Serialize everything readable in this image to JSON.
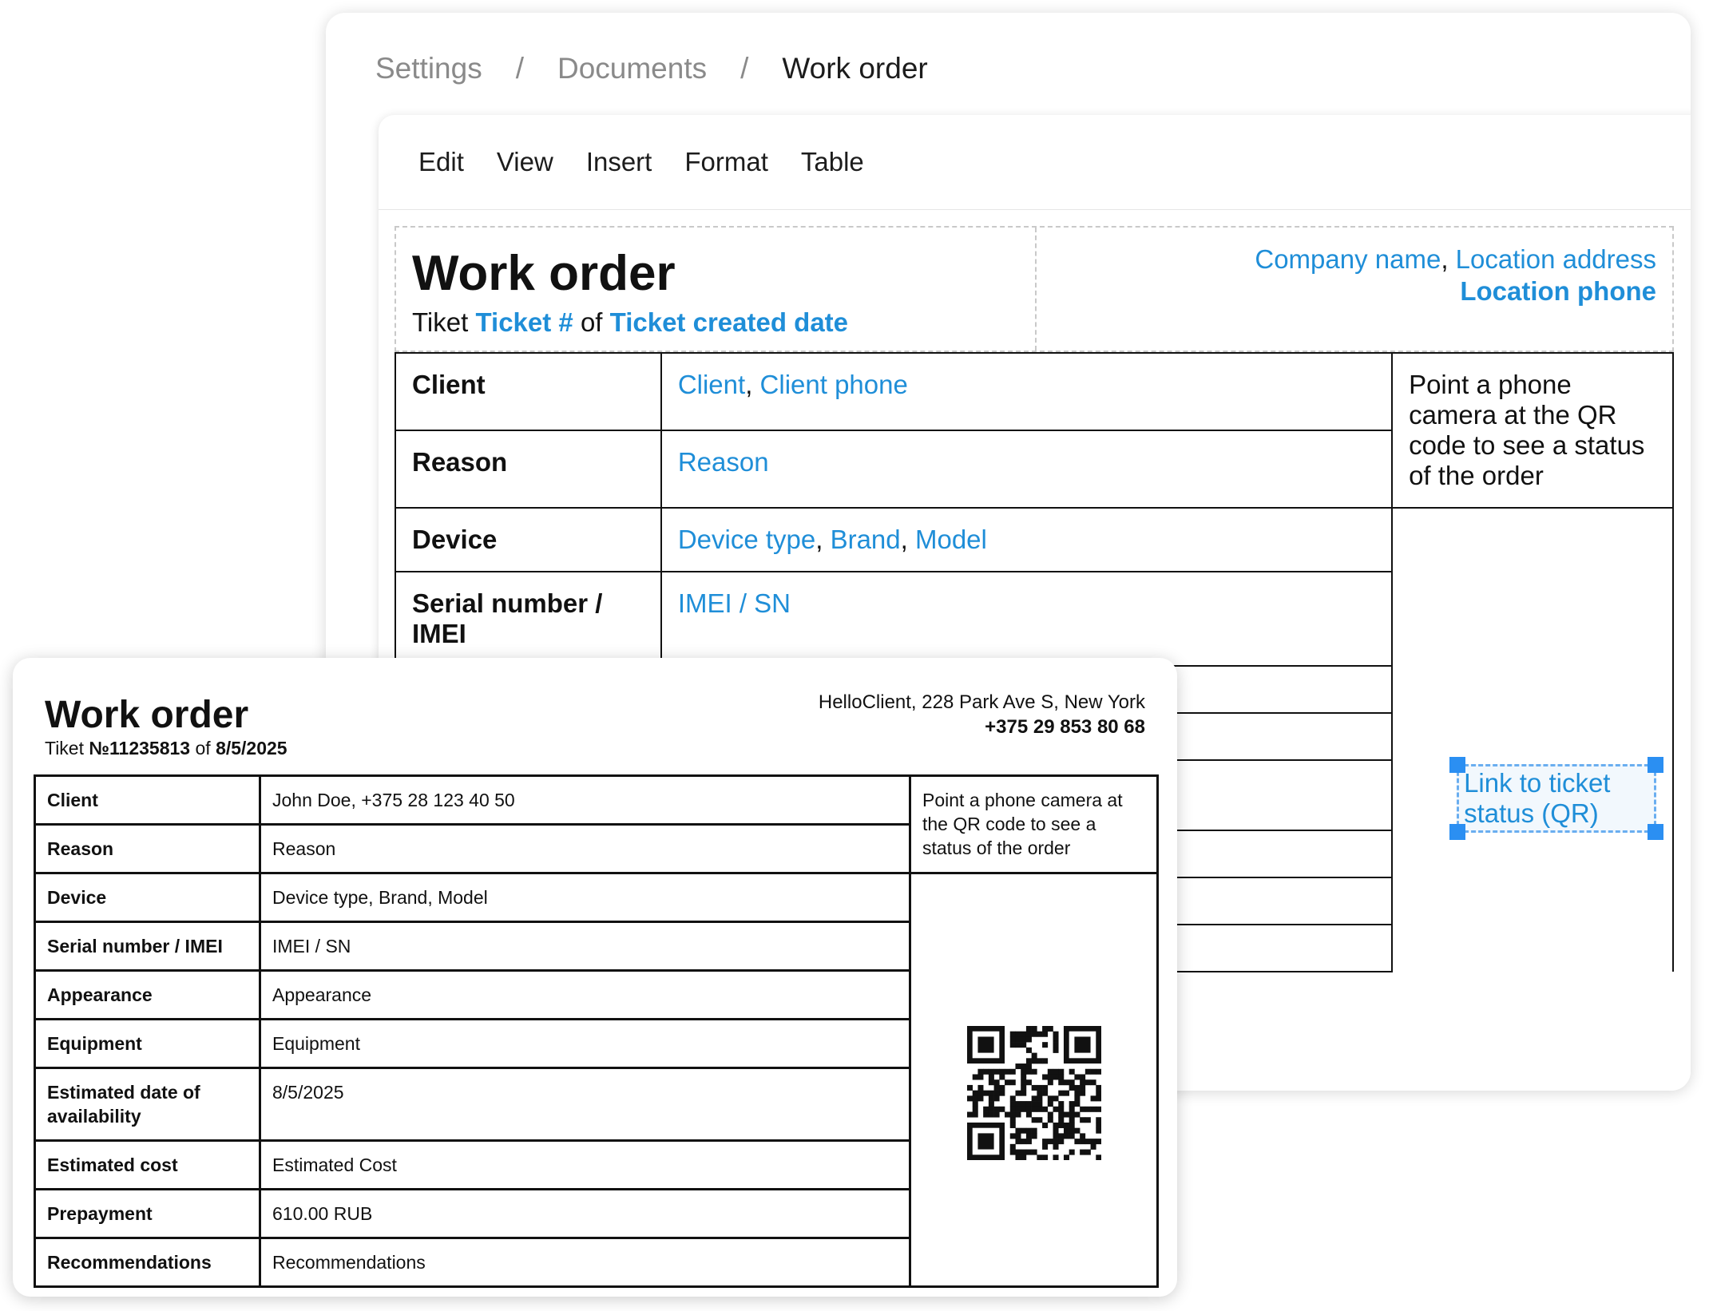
{
  "breadcrumb": {
    "items": [
      "Settings",
      "Documents",
      "Work order"
    ],
    "separator": "/"
  },
  "menu": [
    "Edit",
    "View",
    "Insert",
    "Format",
    "Table"
  ],
  "template": {
    "title": "Work order",
    "ticket_prefix": "Tiket ",
    "ticket_number": "Ticket #",
    "ticket_of": " of ",
    "ticket_date": "Ticket created date",
    "company_name": "Company name",
    "comma": ", ",
    "location_address": "Location address",
    "location_phone": "Location phone",
    "qr_instruction": "Point a phone camera at the QR code to see a status of the order",
    "qr_link": "Link to ticket status (QR)",
    "rows": {
      "client": {
        "label": "Client",
        "v1": "Client",
        "v2": "Client phone"
      },
      "reason": {
        "label": "Reason",
        "v1": "Reason"
      },
      "device": {
        "label": "Device",
        "v1": "Device type",
        "v2": "Brand",
        "v3": "Model"
      },
      "serial": {
        "label": "Serial number / IMEI",
        "v1": "IMEI / SN"
      }
    }
  },
  "preview": {
    "title": "Work order",
    "ticket_prefix": "Tiket ",
    "ticket_number": "№11235813",
    "ticket_of": " of ",
    "ticket_date": "8/5/2025",
    "company_line": "HelloClient, 228 Park Ave S, New York",
    "phone": "+375 29 853 80 68",
    "qr_instruction": "Point a phone camera at the QR code to see a status of the order",
    "rows": [
      {
        "label": "Client",
        "value": "John Doe, +375 28 123 40 50"
      },
      {
        "label": "Reason",
        "value": "Reason"
      },
      {
        "label": "Device",
        "value": "Device type, Brand, Model"
      },
      {
        "label": "Serial number / IMEI",
        "value": "IMEI / SN"
      },
      {
        "label": "Appearance",
        "value": "Appearance"
      },
      {
        "label": "Equipment",
        "value": "Equipment"
      },
      {
        "label": "Estimated date of availability",
        "value": "8/5/2025"
      },
      {
        "label": "Estimated cost",
        "value": "Estimated Cost"
      },
      {
        "label": "Prepayment",
        "value": "610.00 RUB"
      },
      {
        "label": "Recommendations",
        "value": "Recommendations"
      }
    ]
  },
  "colors": {
    "placeholder_blue": "#1f8ed8",
    "selection_blue": "#2b8ff2"
  },
  "icons": {
    "qr": "qr-code-icon"
  }
}
